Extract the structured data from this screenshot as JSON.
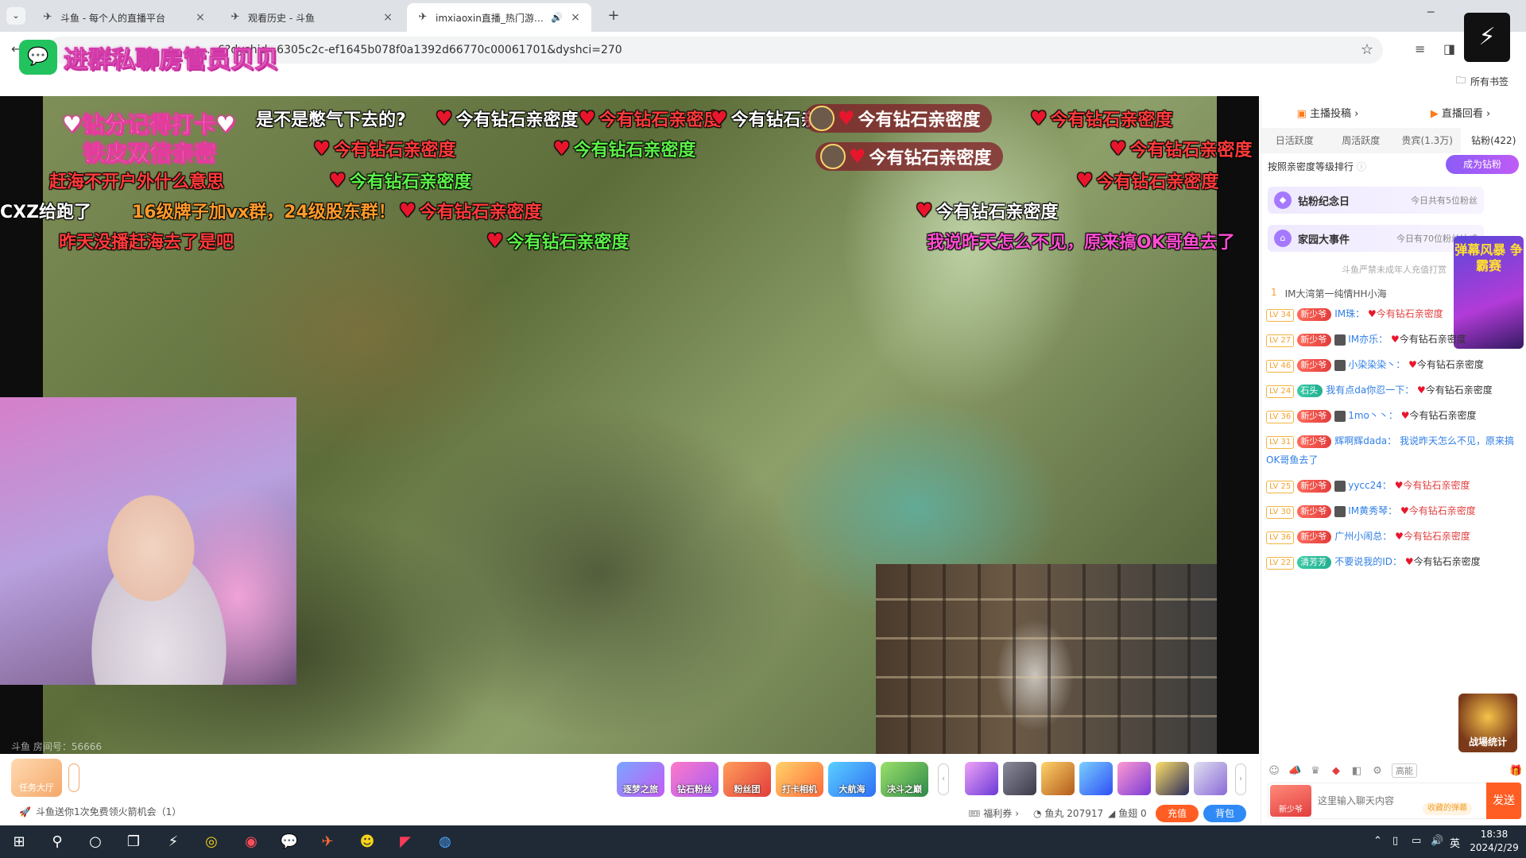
{
  "browser": {
    "tabs": [
      {
        "title": "斗鱼 - 每个人的直播平台",
        "close": "×"
      },
      {
        "title": "观看历史 - 斗鱼",
        "close": "×"
      },
      {
        "title": "imxiaoxin直播_热门游戏直播",
        "close": "×",
        "sound": "🔊"
      }
    ],
    "new_tab": "+",
    "url": "…6?dyshid=6305c2c-ef1645b078f0a1392d66770c00061701&dyshci=270",
    "bookmarks_label": "所有书签"
  },
  "ad_banner": "进群私聊房管员贝贝",
  "video": {
    "overlay_line1": "♥钻分记得打卡♥",
    "overlay_line2": "铁皮双倍亲密",
    "room_number": "斗鱼 房间号：56666"
  },
  "danmaku": [
    {
      "text": "是不是憋气下去的?",
      "color": "white",
      "heart": false
    },
    {
      "text": "今有钻石亲密度",
      "color": "white",
      "heart": true
    },
    {
      "text": "今有钻石亲密度",
      "color": "red",
      "heart": true
    },
    {
      "text": "今有钻石亲",
      "color": "white",
      "heart": true
    },
    {
      "text": "今有钻石亲密度",
      "color": "white",
      "heart": true,
      "pill": true
    },
    {
      "text": "今有钻石亲密度",
      "color": "red",
      "heart": true
    },
    {
      "text": "今有钻石亲密度",
      "color": "red",
      "heart": true
    },
    {
      "text": "今有钻石亲密度",
      "color": "green",
      "heart": true
    },
    {
      "text": "今有钻石亲密度",
      "color": "white",
      "heart": true,
      "pill": true
    },
    {
      "text": "今有钻石亲密度",
      "color": "red",
      "heart": true
    },
    {
      "text": "赶海不开户外什么意思",
      "color": "red",
      "heart": false
    },
    {
      "text": "今有钻石亲密度",
      "color": "green",
      "heart": true
    },
    {
      "text": "今有钻石亲密度",
      "color": "red",
      "heart": true
    },
    {
      "text": "CXZ给跑了",
      "color": "white",
      "heart": false
    },
    {
      "text": "16级牌子加vx群，24级股东群！",
      "color": "orange",
      "heart": false
    },
    {
      "text": "今有钻石亲密度",
      "color": "red",
      "heart": true
    },
    {
      "text": "今有钻石亲密度",
      "color": "white",
      "heart": true
    },
    {
      "text": "昨天没播赶海去了是吧",
      "color": "red",
      "heart": false
    },
    {
      "text": "今有钻石亲密度",
      "color": "green",
      "heart": true
    },
    {
      "text": "我说昨天怎么不见，原来搞OK哥鱼去了",
      "color": "magenta",
      "heart": false
    }
  ],
  "toolbar": {
    "task_hall": "任务大厅",
    "buttons": [
      "逐梦之旅",
      "钻石粉丝",
      "粉丝团",
      "打卡相机",
      "大航海",
      "决斗之巅"
    ],
    "fan_tip": "斗鱼送你1次免费领火箭机会（1）",
    "welfare": "福利券",
    "fish_balls": "鱼丸 207917",
    "fish_fins": "鱼翅 0",
    "recharge": "充值",
    "backpack": "背包"
  },
  "sidebar": {
    "top_links": [
      "主播投稿",
      "直播回看"
    ],
    "rank_tabs": [
      "日活跃度",
      "周活跃度",
      "贵宾(1.3万)",
      "钻粉(422)"
    ],
    "rank_sort": "按照亲密度等级排行",
    "become_fan": "成为钻粉",
    "banner1_title": "钻粉纪念日",
    "banner1_sub": "今日共有5位粉丝",
    "banner2_title": "家园大事件",
    "banner2_sub": "今日有70位粉丝达成",
    "game_ad": "弹幕风暴 争霸赛",
    "notice": "斗鱼严禁未成年人充值打赏",
    "first_msg_rank": "1",
    "first_msg": "IM大湾第一纯情HH小海",
    "messages": [
      {
        "lv": "LV 34",
        "badge": "新少爷",
        "user": "IM珠：",
        "text": "今有钻石亲密度",
        "text_color": "red"
      },
      {
        "lv": "LV 27",
        "badge": "新少爷",
        "user": "IM亦乐：",
        "text": "今有钻石亲密度",
        "text_color": "normal"
      },
      {
        "lv": "LV 46",
        "badge": "新少爷",
        "user": "小染染染丶：",
        "text": "今有钻石亲密度",
        "text_color": "normal"
      },
      {
        "lv": "LV 24",
        "badge": "石头",
        "badge_teal": true,
        "user": "我有点da你忍一下：",
        "text": "今有钻石亲密度",
        "text_color": "normal"
      },
      {
        "lv": "LV 36",
        "badge": "新少爷",
        "user": "1mo丶丶：",
        "text": "今有钻石亲密度",
        "text_color": "normal"
      },
      {
        "lv": "LV 31",
        "badge": "新少爷",
        "user": "辉啊辉dada：",
        "text": "我说昨天怎么不见，原来搞OK哥鱼去了",
        "text_color": "blue",
        "no_heart": true
      },
      {
        "lv": "LV 25",
        "badge": "新少爷",
        "user": "yycc24：",
        "text": "今有钻石亲密度",
        "text_color": "red"
      },
      {
        "lv": "LV 30",
        "badge": "新少爷",
        "user": "IM黄秀琴：",
        "text": "今有钻石亲密度",
        "text_color": "red"
      },
      {
        "lv": "LV 36",
        "badge": "新少爷",
        "user": "广州小闹总：",
        "text": "今有钻石亲密度",
        "text_color": "red"
      },
      {
        "lv": "LV 22",
        "badge": "清芳芳",
        "badge_teal": true,
        "user": "不要说我的ID：",
        "text": "今有钻石亲密度",
        "text_color": "normal"
      }
    ],
    "battle_ad": "战場统计",
    "chat_tools_high": "高能",
    "newbie": "新少爷",
    "input_placeholder": "这里输入聊天内容",
    "collapse": "收藏的弹幕",
    "send": "发送"
  },
  "taskbar": {
    "time": "18:38",
    "date": "2024/2/29",
    "ime": "英"
  }
}
